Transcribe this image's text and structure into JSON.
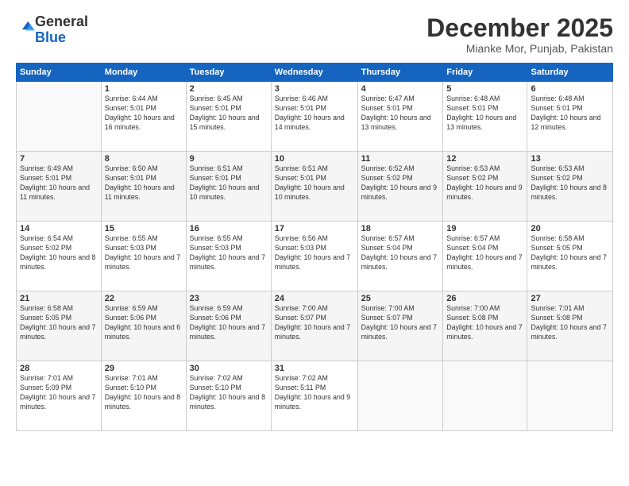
{
  "logo": {
    "general": "General",
    "blue": "Blue"
  },
  "header": {
    "month": "December 2025",
    "location": "Mianke Mor, Punjab, Pakistan"
  },
  "columns": [
    "Sunday",
    "Monday",
    "Tuesday",
    "Wednesday",
    "Thursday",
    "Friday",
    "Saturday"
  ],
  "weeks": [
    [
      {
        "day": "",
        "sunrise": "",
        "sunset": "",
        "daylight": ""
      },
      {
        "day": "1",
        "sunrise": "Sunrise: 6:44 AM",
        "sunset": "Sunset: 5:01 PM",
        "daylight": "Daylight: 10 hours and 16 minutes."
      },
      {
        "day": "2",
        "sunrise": "Sunrise: 6:45 AM",
        "sunset": "Sunset: 5:01 PM",
        "daylight": "Daylight: 10 hours and 15 minutes."
      },
      {
        "day": "3",
        "sunrise": "Sunrise: 6:46 AM",
        "sunset": "Sunset: 5:01 PM",
        "daylight": "Daylight: 10 hours and 14 minutes."
      },
      {
        "day": "4",
        "sunrise": "Sunrise: 6:47 AM",
        "sunset": "Sunset: 5:01 PM",
        "daylight": "Daylight: 10 hours and 13 minutes."
      },
      {
        "day": "5",
        "sunrise": "Sunrise: 6:48 AM",
        "sunset": "Sunset: 5:01 PM",
        "daylight": "Daylight: 10 hours and 13 minutes."
      },
      {
        "day": "6",
        "sunrise": "Sunrise: 6:48 AM",
        "sunset": "Sunset: 5:01 PM",
        "daylight": "Daylight: 10 hours and 12 minutes."
      }
    ],
    [
      {
        "day": "7",
        "sunrise": "Sunrise: 6:49 AM",
        "sunset": "Sunset: 5:01 PM",
        "daylight": "Daylight: 10 hours and 11 minutes."
      },
      {
        "day": "8",
        "sunrise": "Sunrise: 6:50 AM",
        "sunset": "Sunset: 5:01 PM",
        "daylight": "Daylight: 10 hours and 11 minutes."
      },
      {
        "day": "9",
        "sunrise": "Sunrise: 6:51 AM",
        "sunset": "Sunset: 5:01 PM",
        "daylight": "Daylight: 10 hours and 10 minutes."
      },
      {
        "day": "10",
        "sunrise": "Sunrise: 6:51 AM",
        "sunset": "Sunset: 5:01 PM",
        "daylight": "Daylight: 10 hours and 10 minutes."
      },
      {
        "day": "11",
        "sunrise": "Sunrise: 6:52 AM",
        "sunset": "Sunset: 5:02 PM",
        "daylight": "Daylight: 10 hours and 9 minutes."
      },
      {
        "day": "12",
        "sunrise": "Sunrise: 6:53 AM",
        "sunset": "Sunset: 5:02 PM",
        "daylight": "Daylight: 10 hours and 9 minutes."
      },
      {
        "day": "13",
        "sunrise": "Sunrise: 6:53 AM",
        "sunset": "Sunset: 5:02 PM",
        "daylight": "Daylight: 10 hours and 8 minutes."
      }
    ],
    [
      {
        "day": "14",
        "sunrise": "Sunrise: 6:54 AM",
        "sunset": "Sunset: 5:02 PM",
        "daylight": "Daylight: 10 hours and 8 minutes."
      },
      {
        "day": "15",
        "sunrise": "Sunrise: 6:55 AM",
        "sunset": "Sunset: 5:03 PM",
        "daylight": "Daylight: 10 hours and 7 minutes."
      },
      {
        "day": "16",
        "sunrise": "Sunrise: 6:55 AM",
        "sunset": "Sunset: 5:03 PM",
        "daylight": "Daylight: 10 hours and 7 minutes."
      },
      {
        "day": "17",
        "sunrise": "Sunrise: 6:56 AM",
        "sunset": "Sunset: 5:03 PM",
        "daylight": "Daylight: 10 hours and 7 minutes."
      },
      {
        "day": "18",
        "sunrise": "Sunrise: 6:57 AM",
        "sunset": "Sunset: 5:04 PM",
        "daylight": "Daylight: 10 hours and 7 minutes."
      },
      {
        "day": "19",
        "sunrise": "Sunrise: 6:57 AM",
        "sunset": "Sunset: 5:04 PM",
        "daylight": "Daylight: 10 hours and 7 minutes."
      },
      {
        "day": "20",
        "sunrise": "Sunrise: 6:58 AM",
        "sunset": "Sunset: 5:05 PM",
        "daylight": "Daylight: 10 hours and 7 minutes."
      }
    ],
    [
      {
        "day": "21",
        "sunrise": "Sunrise: 6:58 AM",
        "sunset": "Sunset: 5:05 PM",
        "daylight": "Daylight: 10 hours and 7 minutes."
      },
      {
        "day": "22",
        "sunrise": "Sunrise: 6:59 AM",
        "sunset": "Sunset: 5:06 PM",
        "daylight": "Daylight: 10 hours and 6 minutes."
      },
      {
        "day": "23",
        "sunrise": "Sunrise: 6:59 AM",
        "sunset": "Sunset: 5:06 PM",
        "daylight": "Daylight: 10 hours and 7 minutes."
      },
      {
        "day": "24",
        "sunrise": "Sunrise: 7:00 AM",
        "sunset": "Sunset: 5:07 PM",
        "daylight": "Daylight: 10 hours and 7 minutes."
      },
      {
        "day": "25",
        "sunrise": "Sunrise: 7:00 AM",
        "sunset": "Sunset: 5:07 PM",
        "daylight": "Daylight: 10 hours and 7 minutes."
      },
      {
        "day": "26",
        "sunrise": "Sunrise: 7:00 AM",
        "sunset": "Sunset: 5:08 PM",
        "daylight": "Daylight: 10 hours and 7 minutes."
      },
      {
        "day": "27",
        "sunrise": "Sunrise: 7:01 AM",
        "sunset": "Sunset: 5:08 PM",
        "daylight": "Daylight: 10 hours and 7 minutes."
      }
    ],
    [
      {
        "day": "28",
        "sunrise": "Sunrise: 7:01 AM",
        "sunset": "Sunset: 5:09 PM",
        "daylight": "Daylight: 10 hours and 7 minutes."
      },
      {
        "day": "29",
        "sunrise": "Sunrise: 7:01 AM",
        "sunset": "Sunset: 5:10 PM",
        "daylight": "Daylight: 10 hours and 8 minutes."
      },
      {
        "day": "30",
        "sunrise": "Sunrise: 7:02 AM",
        "sunset": "Sunset: 5:10 PM",
        "daylight": "Daylight: 10 hours and 8 minutes."
      },
      {
        "day": "31",
        "sunrise": "Sunrise: 7:02 AM",
        "sunset": "Sunset: 5:11 PM",
        "daylight": "Daylight: 10 hours and 9 minutes."
      },
      {
        "day": "",
        "sunrise": "",
        "sunset": "",
        "daylight": ""
      },
      {
        "day": "",
        "sunrise": "",
        "sunset": "",
        "daylight": ""
      },
      {
        "day": "",
        "sunrise": "",
        "sunset": "",
        "daylight": ""
      }
    ]
  ]
}
